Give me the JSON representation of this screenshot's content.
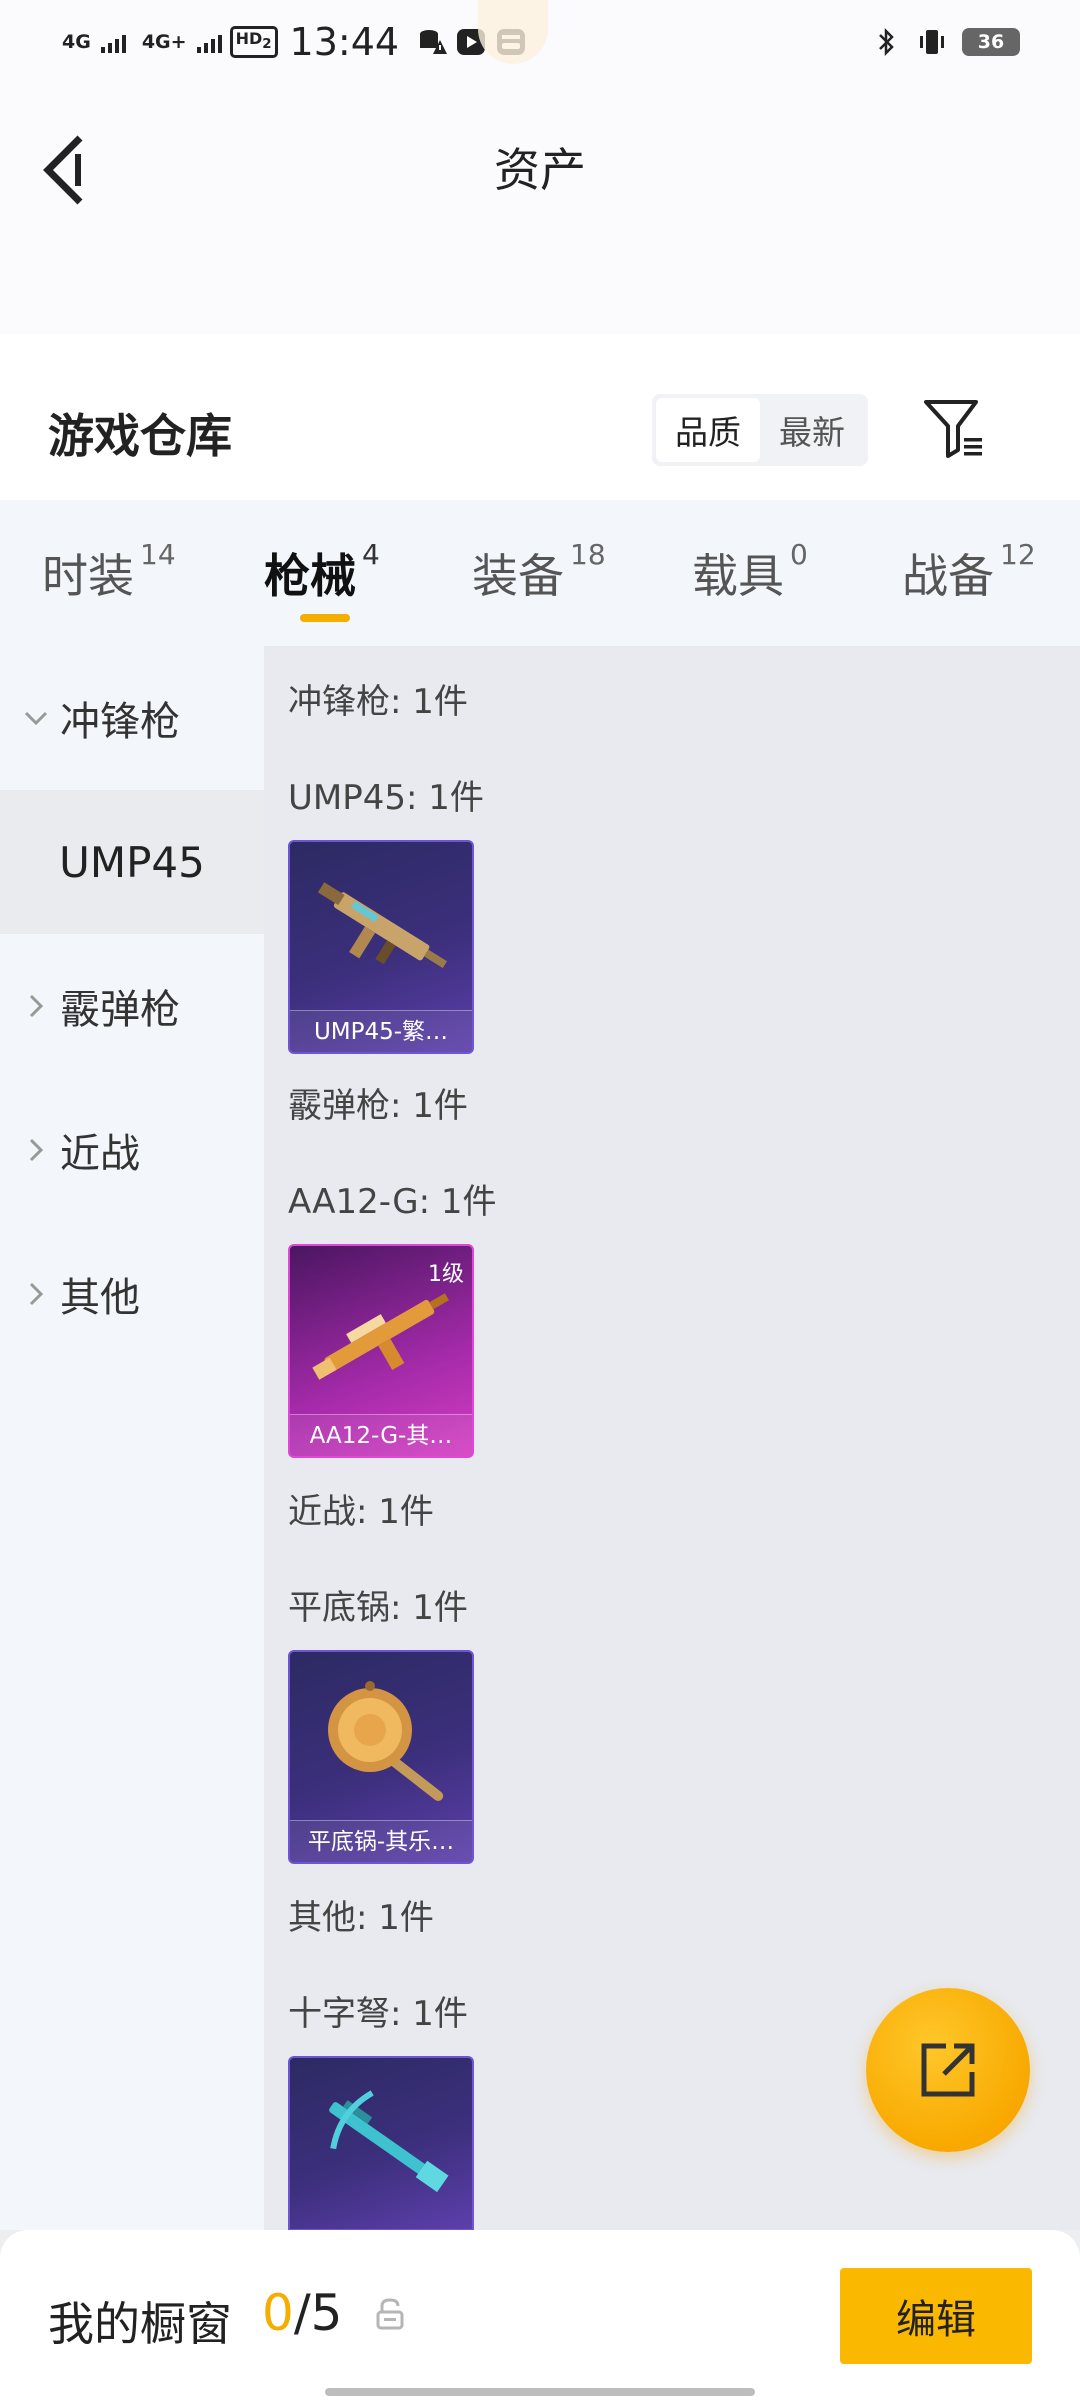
{
  "status_bar": {
    "network1": "4G",
    "network2": "4G+",
    "hd": "HD",
    "hd_sub": "2",
    "time": "13:44",
    "battery": "36"
  },
  "header": {
    "title": "资产"
  },
  "warehouse": {
    "title": "游戏仓库",
    "sort_options": [
      "品质",
      "最新"
    ],
    "sort_selected": "品质"
  },
  "tabs": [
    {
      "label": "时装",
      "count": "14",
      "active": false
    },
    {
      "label": "枪械",
      "count": "4",
      "active": true
    },
    {
      "label": "装备",
      "count": "18",
      "active": false
    },
    {
      "label": "载具",
      "count": "0",
      "active": false
    },
    {
      "label": "战备",
      "count": "12",
      "active": false
    }
  ],
  "sidebar": {
    "items": [
      {
        "label": "冲锋枪",
        "expanded": true
      },
      {
        "label": "UMP45",
        "sub": true,
        "selected": true
      },
      {
        "label": "霰弹枪",
        "expanded": false
      },
      {
        "label": "近战",
        "expanded": false
      },
      {
        "label": "其他",
        "expanded": false
      }
    ]
  },
  "content": {
    "groups": [
      {
        "category": "冲锋枪: 1件",
        "weapon": "UMP45: 1件",
        "card": {
          "label": "UMP45-繁…",
          "level": "",
          "rarity": "purple"
        }
      },
      {
        "category": "霰弹枪: 1件",
        "weapon": "AA12-G: 1件",
        "card": {
          "label": "AA12-G-其…",
          "level": "1级",
          "rarity": "pink"
        }
      },
      {
        "category": "近战: 1件",
        "weapon": "平底锅: 1件",
        "card": {
          "label": "平底锅-其乐…",
          "level": "",
          "rarity": "purple"
        }
      },
      {
        "category": "其他: 1件",
        "weapon": "十字弩: 1件",
        "card": {
          "label": "",
          "level": "",
          "rarity": "purple"
        }
      }
    ]
  },
  "bottom_bar": {
    "showcase_label": "我的橱窗",
    "showcase_current": "0",
    "showcase_total": "/5",
    "edit_label": "编辑"
  },
  "colors": {
    "accent": "#f5ad00",
    "edit_button": "#fbb800",
    "rarity_purple": "#5d3fab",
    "rarity_pink": "#d43fc3"
  }
}
